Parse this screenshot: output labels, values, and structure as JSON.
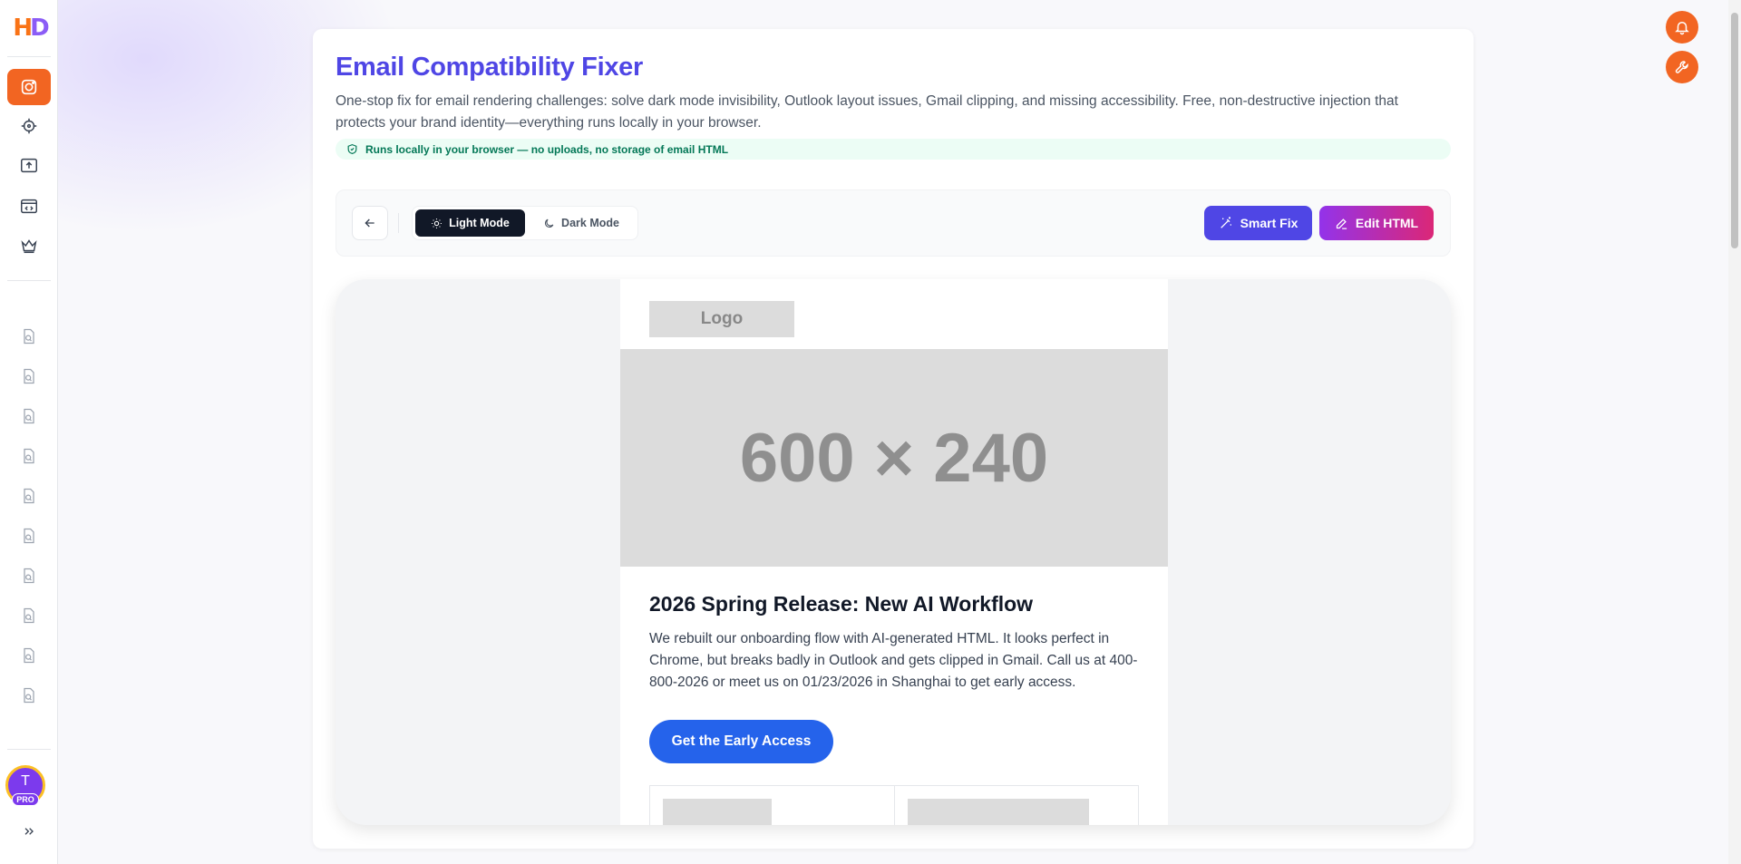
{
  "app": {
    "logo_text_h": "H",
    "logo_text_d": "D",
    "brand_color": "#f26522"
  },
  "sidebar": {
    "top_items": [
      {
        "icon": "email-fixer-icon",
        "active": true
      },
      {
        "icon": "target-icon",
        "active": false
      },
      {
        "icon": "upload-icon",
        "active": false
      },
      {
        "icon": "code-icon",
        "active": false
      },
      {
        "icon": "crown-icon",
        "active": false
      }
    ],
    "history_item_icon": "file-search-icon",
    "history_item_count": 10,
    "avatar_initial": "T",
    "pro_badge": "PRO",
    "expand_icon": "double-chevron-right-icon"
  },
  "header": {
    "title": "Email Compatibility Fixer",
    "subtitle": "One-stop fix for email rendering challenges: solve dark mode invisibility, Outlook layout issues, Gmail clipping, and missing accessibility. Free, non-destructive injection that protects your brand identity—everything runs locally in your browser.",
    "privacy_note": "Runs locally in your browser — no uploads, no storage of email HTML"
  },
  "toolbar": {
    "light_mode_label": "Light Mode",
    "dark_mode_label": "Dark Mode",
    "selected_mode": "Light Mode",
    "smart_fix_label": "Smart Fix",
    "edit_html_label": "Edit HTML"
  },
  "email_preview": {
    "logo_placeholder": "Logo",
    "hero_placeholder": "600 × 240",
    "headline": "2026 Spring Release: New AI Workflow",
    "body": "We rebuilt our onboarding flow with AI-generated HTML. It looks perfect in Chrome, but breaks badly in Outlook and gets clipped in Gmail. Call us at 400-800-2026 or meet us on 01/23/2026 in Shanghai to get early access.",
    "cta_label": "Get the Early Access"
  },
  "top_right": {
    "notification_icon": "bell-icon",
    "tools_icon": "wrench-icon"
  }
}
